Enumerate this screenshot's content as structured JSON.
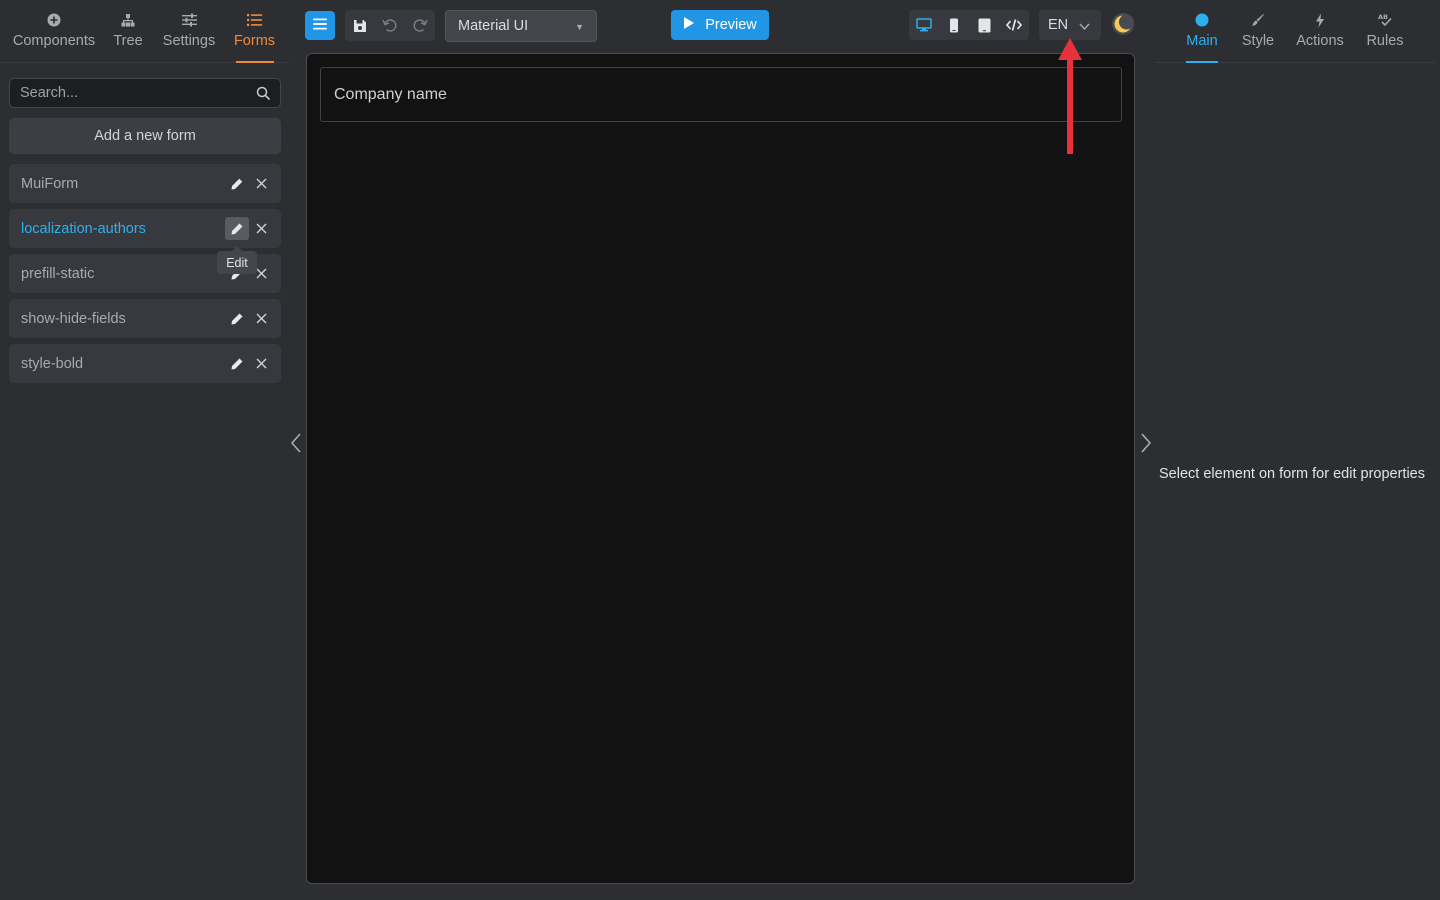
{
  "left_tabs": [
    {
      "label": "Components",
      "icon": "plus-circle-icon"
    },
    {
      "label": "Tree",
      "icon": "tree-icon"
    },
    {
      "label": "Settings",
      "icon": "sliders-icon"
    },
    {
      "label": "Forms",
      "icon": "list-icon",
      "active": true
    }
  ],
  "search": {
    "placeholder": "Search...",
    "value": ""
  },
  "add_form_label": "Add a new form",
  "forms": [
    {
      "name": "MuiForm"
    },
    {
      "name": "localization-authors",
      "selected": true
    },
    {
      "name": "prefill-static"
    },
    {
      "name": "show-hide-fields"
    },
    {
      "name": "style-bold"
    }
  ],
  "tooltip_label": "Edit",
  "toolbar": {
    "theme_select": "Material UI",
    "preview_label": "Preview",
    "language": "EN"
  },
  "canvas": {
    "field_label": "Company name"
  },
  "right_tabs": [
    {
      "label": "Main",
      "icon": "circle-dot-icon",
      "active": true
    },
    {
      "label": "Style",
      "icon": "brush-icon"
    },
    {
      "label": "Actions",
      "icon": "lightning-icon"
    },
    {
      "label": "Rules",
      "icon": "ab-check-icon"
    }
  ],
  "right_message": "Select element on form for edit properties",
  "colors": {
    "accent_blue": "#2196e6",
    "tab_orange": "#f08a3a",
    "selected_text": "#2db0ee",
    "annotation_red": "#e5323c"
  }
}
